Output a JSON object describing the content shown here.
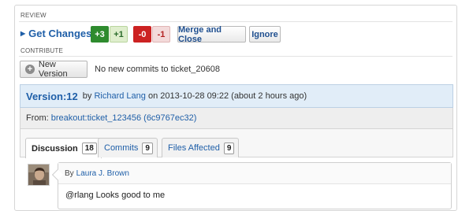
{
  "review": {
    "section_label": "REVIEW",
    "get_changes_label": "Get Changes",
    "scores": {
      "plus3": "+3",
      "plus1": "+1",
      "minus0": "-0",
      "minus1": "-1"
    },
    "merge_close_label": "Merge and Close",
    "ignore_label": "Ignore",
    "colors": {
      "positive_bg": "#2e8b2e",
      "positive_light_bg": "#dfeecd",
      "negative_bg": "#cc2222",
      "negative_light_bg": "#f3dada"
    }
  },
  "contribute": {
    "section_label": "CONTRIBUTE",
    "new_version_label": "New Version",
    "status_text": "No new commits to ticket_20608"
  },
  "version": {
    "title": "Version:12",
    "by_text": "by",
    "author": "Richard Lang",
    "on_text": "on 2013-10-28 09:22 (about 2 hours ago)",
    "from_label": "From:",
    "from_ref": "breakout:ticket_123456 (6c9767ec32)"
  },
  "tabs": [
    {
      "label": "Discussion",
      "count": "18",
      "active": true
    },
    {
      "label": "Commits",
      "count": "9",
      "active": false
    },
    {
      "label": "Files Affected",
      "count": "9",
      "active": false
    }
  ],
  "comment": {
    "by_text": "By",
    "author": "Laura J. Brown",
    "body": "@rlang Looks good to me"
  }
}
